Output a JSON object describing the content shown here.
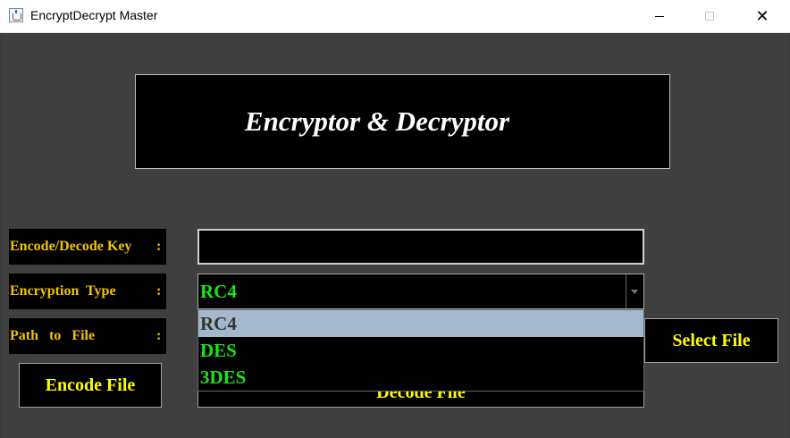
{
  "window": {
    "title": "EncryptDecrypt Master",
    "close_glyph": "✕"
  },
  "header": {
    "title": "Encryptor & Decryptor"
  },
  "labels": {
    "key": "Encode/Decode Key",
    "type": "Encryption  Type",
    "path": "Path   to   File",
    "colon": ":"
  },
  "key_input": {
    "value": ""
  },
  "encryption_type": {
    "selected": "RC4",
    "options": [
      "RC4",
      "DES",
      "3DES"
    ],
    "highlighted_index": 0
  },
  "buttons": {
    "select_file": "Select File",
    "encode_file": "Encode File",
    "decode_file": "Decode File"
  },
  "colors": {
    "label_text": "#f2c200",
    "button_text": "#ffff00",
    "option_text": "#19e619",
    "highlight_bg": "#a3b8cc"
  }
}
